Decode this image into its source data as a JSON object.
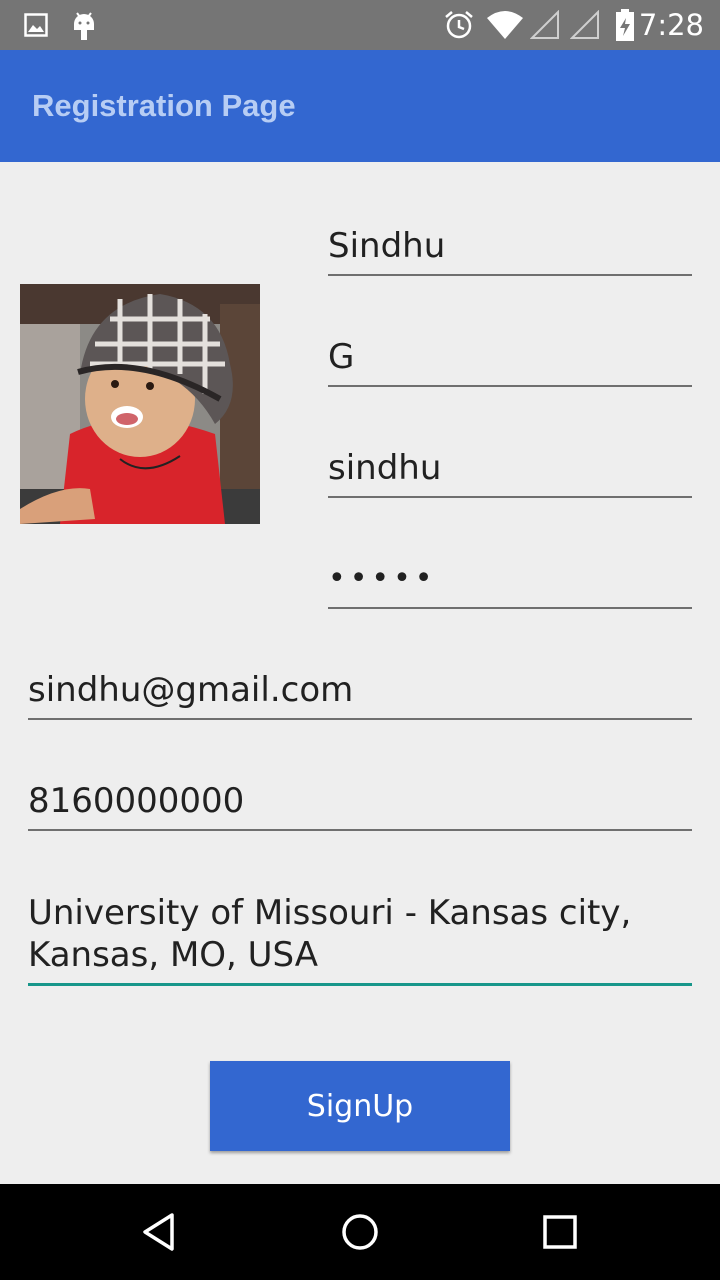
{
  "status_bar": {
    "time": "7:28",
    "icons": [
      "image-icon",
      "android-icon",
      "alarm-icon",
      "wifi-icon",
      "signal-icon",
      "signal-icon",
      "battery-icon"
    ]
  },
  "app_bar": {
    "title": "Registration Page"
  },
  "form": {
    "first_name": "Sindhu",
    "last_name": "G",
    "username": "sindhu",
    "password_mask": "•••••",
    "email": "sindhu@gmail.com",
    "phone": "8160000000",
    "address_line1": "University of Missouri - Kansas city,",
    "address_line2": "Kansas, MO, USA"
  },
  "signup_button": {
    "label": "SignUp"
  },
  "colors": {
    "primary": "#3367d0",
    "accent": "#17968a",
    "background": "#eeeeee"
  },
  "nav_bar": {
    "icons": [
      "back-icon",
      "home-icon",
      "recents-icon"
    ]
  }
}
